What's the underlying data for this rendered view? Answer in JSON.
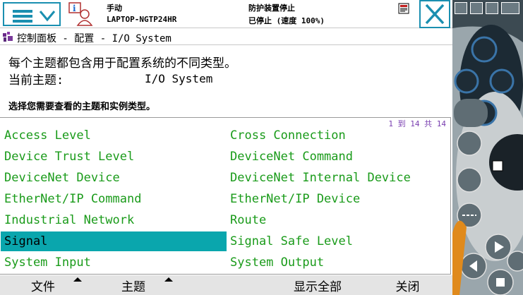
{
  "topbar": {
    "status_mode": "手动",
    "status_host": "LAPTOP-NGTP24HR",
    "status_safety": "防护装置停止",
    "status_state": "已停止 (速度 100%)"
  },
  "breadcrumb": {
    "text": "控制面板 - 配置 - I/O System"
  },
  "info": {
    "description": "每个主题都包含用于配置系统的不同类型。",
    "current_topic_label": "当前主题:",
    "current_topic_value": "I/O System",
    "prompt": "选择您需要查看的主题和实例类型。"
  },
  "list": {
    "pagination": "1 到 14 共 14",
    "selected": "Signal",
    "items": [
      "Access Level",
      "Cross Connection",
      "Device Trust Level",
      "DeviceNet Command",
      "DeviceNet Device",
      "DeviceNet Internal Device",
      "EtherNet/IP Command",
      "EtherNet/IP Device",
      "Industrial Network",
      "Route",
      "Signal",
      "Signal Safe Level",
      "System Input",
      "System Output"
    ]
  },
  "toolbar": {
    "file_label": "文件",
    "theme_label": "主题",
    "show_all_label": "显示全部",
    "close_label": "关闭"
  },
  "colors": {
    "accent": "#1a8fb0",
    "item_text": "#1a9b1a",
    "selected_bg": "#0aa6ad",
    "pagination": "#7a3fb0"
  },
  "icons": {
    "menu": "hamburger-chevron-icon",
    "user": "user-info-icon",
    "notify": "event-log-icon",
    "close": "close-x-icon",
    "breadcrumb": "control-panel-icon"
  }
}
